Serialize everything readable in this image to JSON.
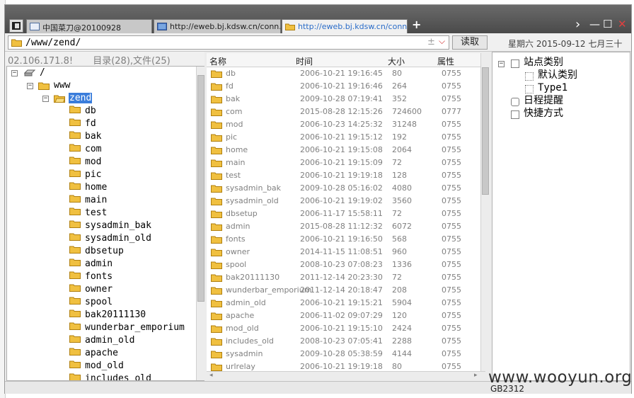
{
  "titlebar": {
    "tabs": [
      {
        "label": "中国菜刀@20100928",
        "active": false
      },
      {
        "label": "http://eweb.bj.kdsw.cn/conn...",
        "active": false
      },
      {
        "label": "http://eweb.bj.kdsw.cn/conn...",
        "active": true
      }
    ],
    "new_tab_label": "+",
    "chevron_label": "›",
    "minimize_label": "—",
    "maximize_label": "☐",
    "close_label": "✕"
  },
  "toolbar": {
    "path": "/www/zend/",
    "plus_minus": "±",
    "dropdown_label": "⌵",
    "read_button": "读取",
    "date": "星期六 2015-09-12 七月三十"
  },
  "left_panel": {
    "ip": "02.106.171.8!",
    "summary": "目录(28),文件(25)"
  },
  "tree": {
    "root": "/",
    "www": "www",
    "zend": "zend",
    "children": [
      "db",
      "fd",
      "bak",
      "com",
      "mod",
      "pic",
      "home",
      "main",
      "test",
      "sysadmin_bak",
      "sysadmin_old",
      "dbsetup",
      "admin",
      "fonts",
      "owner",
      "spool",
      "bak20111130",
      "wunderbar_emporium",
      "admin_old",
      "apache",
      "mod_old",
      "includes_old"
    ]
  },
  "file_list": {
    "columns": {
      "name": "名称",
      "time": "时间",
      "size": "大小",
      "perm": "属性"
    },
    "rows": [
      {
        "name": "db",
        "time": "2006-10-21 19:16:45",
        "size": "80",
        "perm": "0755"
      },
      {
        "name": "fd",
        "time": "2006-10-21 19:16:46",
        "size": "264",
        "perm": "0755"
      },
      {
        "name": "bak",
        "time": "2009-10-28 07:19:41",
        "size": "352",
        "perm": "0755"
      },
      {
        "name": "com",
        "time": "2015-08-28 12:15:26",
        "size": "724600",
        "perm": "0777"
      },
      {
        "name": "mod",
        "time": "2006-10-23 14:25:32",
        "size": "31248",
        "perm": "0755"
      },
      {
        "name": "pic",
        "time": "2006-10-21 19:15:12",
        "size": "192",
        "perm": "0755"
      },
      {
        "name": "home",
        "time": "2006-10-21 19:15:08",
        "size": "2064",
        "perm": "0755"
      },
      {
        "name": "main",
        "time": "2006-10-21 19:15:09",
        "size": "72",
        "perm": "0755"
      },
      {
        "name": "test",
        "time": "2006-10-21 19:19:18",
        "size": "128",
        "perm": "0755"
      },
      {
        "name": "sysadmin_bak",
        "time": "2009-10-28 05:16:02",
        "size": "4080",
        "perm": "0755"
      },
      {
        "name": "sysadmin_old",
        "time": "2006-10-21 19:19:02",
        "size": "3560",
        "perm": "0755"
      },
      {
        "name": "dbsetup",
        "time": "2006-11-17 15:58:11",
        "size": "72",
        "perm": "0755"
      },
      {
        "name": "admin",
        "time": "2015-08-28 11:12:32",
        "size": "6072",
        "perm": "0755"
      },
      {
        "name": "fonts",
        "time": "2006-10-21 19:16:50",
        "size": "568",
        "perm": "0755"
      },
      {
        "name": "owner",
        "time": "2014-11-15 11:08:51",
        "size": "960",
        "perm": "0755"
      },
      {
        "name": "spool",
        "time": "2008-10-23 07:08:23",
        "size": "1336",
        "perm": "0755"
      },
      {
        "name": "bak20111130",
        "time": "2011-12-14 20:23:30",
        "size": "72",
        "perm": "0755"
      },
      {
        "name": "wunderbar_emporium",
        "time": "2011-12-14 20:18:47",
        "size": "208",
        "perm": "0755"
      },
      {
        "name": "admin_old",
        "time": "2006-10-21 19:15:21",
        "size": "5904",
        "perm": "0755"
      },
      {
        "name": "apache",
        "time": "2006-11-02 09:07:29",
        "size": "120",
        "perm": "0755"
      },
      {
        "name": "mod_old",
        "time": "2006-10-21 19:15:10",
        "size": "2424",
        "perm": "0755"
      },
      {
        "name": "includes_old",
        "time": "2008-10-23 07:05:41",
        "size": "2288",
        "perm": "0755"
      },
      {
        "name": "sysadmin",
        "time": "2009-10-28 05:38:59",
        "size": "4144",
        "perm": "0755"
      },
      {
        "name": "urlrelay",
        "time": "2006-10-21 19:19:18",
        "size": "80",
        "perm": "0755"
      }
    ]
  },
  "right_panel": {
    "site_category": "站点类别",
    "default_category": "默认类别",
    "type1": "Type1",
    "schedule": "日程提醒",
    "shortcuts": "快捷方式"
  },
  "status": {
    "encoding": "GB2312"
  },
  "watermark": "www.wooyun.org",
  "colors": {
    "selection": "#3a7ddb",
    "active_tab_text": "#2a6cc8",
    "folder": "#f0c040",
    "titlebar": "#4a4a4a"
  }
}
